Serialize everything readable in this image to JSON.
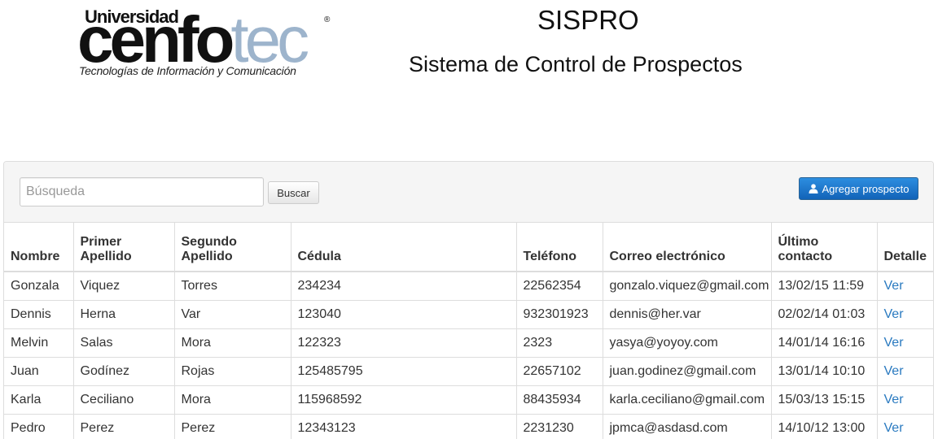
{
  "logo": {
    "line1": "Universidad",
    "brand_dark": "cenfo",
    "brand_light": "tec",
    "registered": "®",
    "tagline": "Tecnologías de Información y Comunicación"
  },
  "header": {
    "title": "SISPRO",
    "subtitle": "Sistema de Control de Prospectos"
  },
  "toolbar": {
    "search_placeholder": "Búsqueda",
    "search_value": "",
    "search_label": "Buscar",
    "add_label": "Agregar prospecto",
    "add_icon": "user-icon"
  },
  "colors": {
    "primary_button": "#1a72c9",
    "link": "#2a7ac0",
    "brand_light": "#9db4cc"
  },
  "table": {
    "headers": [
      {
        "line1": "Nombre",
        "line2": ""
      },
      {
        "line1": "Primer",
        "line2": "Apellido"
      },
      {
        "line1": "Segundo",
        "line2": "Apellido"
      },
      {
        "line1": "Cédula",
        "line2": ""
      },
      {
        "line1": "Teléfono",
        "line2": ""
      },
      {
        "line1": "Correo electrónico",
        "line2": ""
      },
      {
        "line1": "Último",
        "line2": "contacto"
      },
      {
        "line1": "Detalle",
        "line2": ""
      }
    ],
    "rows": [
      {
        "nombre": "Gonzala",
        "primer": "Viquez",
        "segundo": "Torres",
        "cedula": "234234",
        "telefono": "22562354",
        "correo": "gonzalo.viquez@gmail.com",
        "contacto": "13/02/15 11:59",
        "detalle": "Ver"
      },
      {
        "nombre": "Dennis",
        "primer": "Herna",
        "segundo": "Var",
        "cedula": "123040",
        "telefono": "932301923",
        "correo": "dennis@her.var",
        "contacto": "02/02/14 01:03",
        "detalle": "Ver"
      },
      {
        "nombre": "Melvin",
        "primer": "Salas",
        "segundo": "Mora",
        "cedula": "122323",
        "telefono": "2323",
        "correo": "yasya@yoyoy.com",
        "contacto": "14/01/14 16:16",
        "detalle": "Ver"
      },
      {
        "nombre": "Juan",
        "primer": "Godínez",
        "segundo": "Rojas",
        "cedula": "125485795",
        "telefono": "22657102",
        "correo": "juan.godinez@gmail.com",
        "contacto": "13/01/14 10:10",
        "detalle": "Ver"
      },
      {
        "nombre": "Karla",
        "primer": "Ceciliano",
        "segundo": "Mora",
        "cedula": "115968592",
        "telefono": "88435934",
        "correo": "karla.ceciliano@gmail.com",
        "contacto": "15/03/13 15:15",
        "detalle": "Ver"
      },
      {
        "nombre": "Pedro",
        "primer": "Perez",
        "segundo": "Perez",
        "cedula": "12343123",
        "telefono": "2231230",
        "correo": "jpmca@asdasd.com",
        "contacto": "14/10/12 13:00",
        "detalle": "Ver"
      }
    ]
  }
}
